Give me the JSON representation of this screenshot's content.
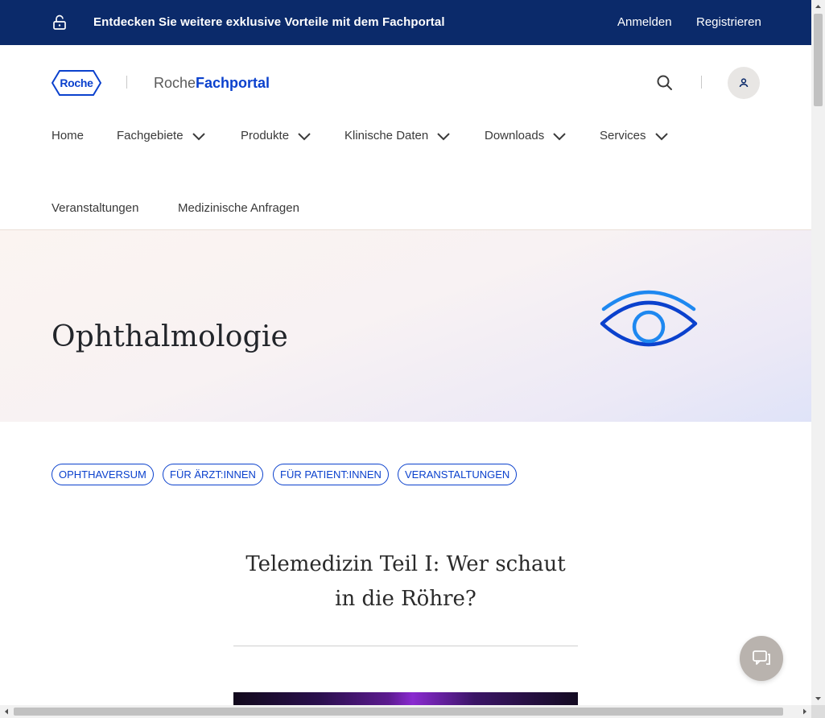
{
  "topbar": {
    "lock_icon": "unlock-icon",
    "promo": "Entdecken Sie weitere exklusive Vorteile mit dem Fachportal",
    "login": "Anmelden",
    "register": "Registrieren"
  },
  "header": {
    "logo_text": "Roche",
    "portal_prefix": "Roche",
    "portal_name": "Fachportal",
    "search_icon": "search-icon",
    "user_icon": "user-icon"
  },
  "nav": {
    "items": [
      {
        "label": "Home"
      },
      {
        "label": "Fachgebiete"
      },
      {
        "label": "Produkte"
      },
      {
        "label": "Klinische Daten"
      },
      {
        "label": "Downloads"
      },
      {
        "label": "Services"
      },
      {
        "label": "Veranstaltungen"
      },
      {
        "label": "Medizinische Anfragen"
      }
    ]
  },
  "hero": {
    "title": "Ophthalmologie",
    "icon": "eye-icon"
  },
  "tags": [
    {
      "label": "OPHTHAVERSUM"
    },
    {
      "label": "FÜR ÄRZT:INNEN"
    },
    {
      "label": "FÜR PATIENT:INNEN"
    },
    {
      "label": "VERANSTALTUNGEN"
    }
  ],
  "article": {
    "title": "Telemedizin Teil I: Wer schaut in die Röhre?"
  },
  "chat": {
    "icon": "chat-icon"
  },
  "colors": {
    "topbar": "#0b2a6a",
    "brand_blue": "#0b41cd",
    "eye_light": "#1e88f0",
    "eye_dark": "#0b41cd"
  }
}
